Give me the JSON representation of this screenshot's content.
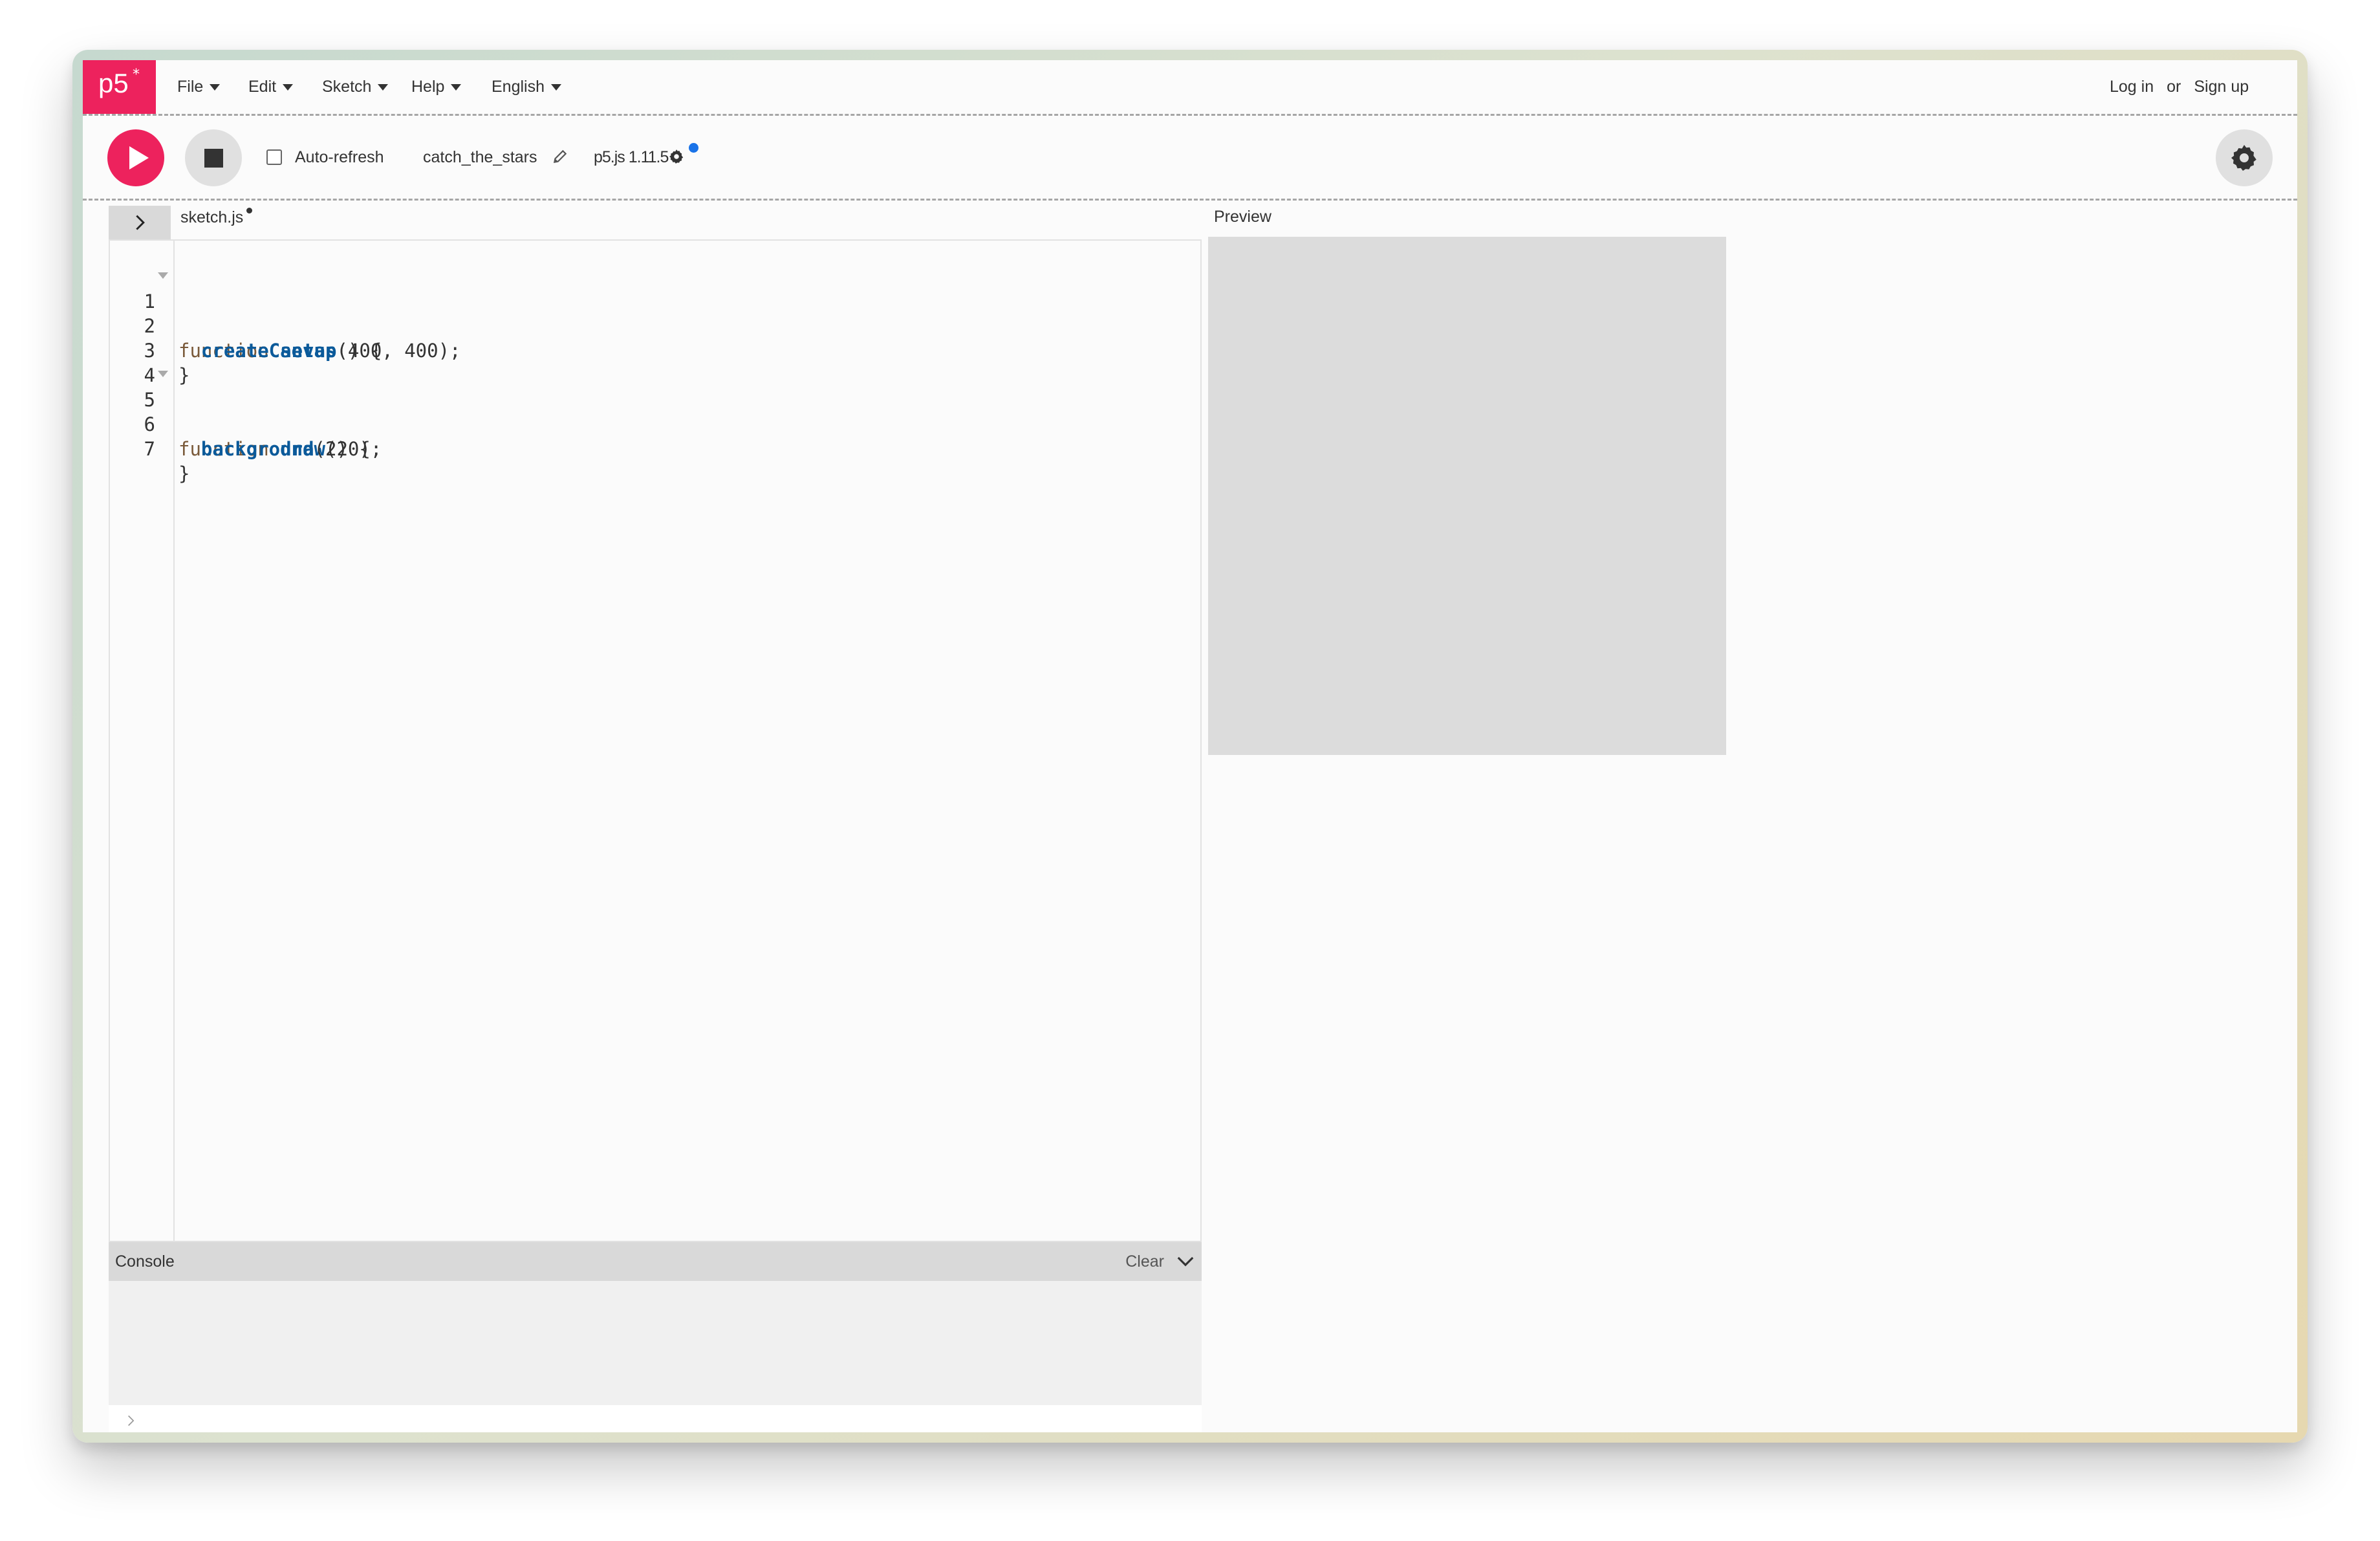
{
  "nav": {
    "logo": "p5",
    "logo_star": "*",
    "menus": [
      "File",
      "Edit",
      "Sketch",
      "Help",
      "English"
    ],
    "login": "Log in",
    "or": "or",
    "signup": "Sign up"
  },
  "toolbar": {
    "auto_refresh_label": "Auto-refresh",
    "auto_refresh_checked": false,
    "sketch_name": "catch_the_stars",
    "version": "p5.js 1.11.5"
  },
  "editor": {
    "file_name": "sketch.js",
    "lines": [
      {
        "no": "1",
        "fold": true
      },
      {
        "no": "2",
        "fold": false
      },
      {
        "no": "3",
        "fold": false
      },
      {
        "no": "4",
        "fold": false
      },
      {
        "no": "5",
        "fold": true
      },
      {
        "no": "6",
        "fold": false
      },
      {
        "no": "7",
        "fold": false
      }
    ],
    "code": {
      "l1_kw": "function",
      "l1_fn": "setup",
      "l1_rest": "() {",
      "l2_fn": "createCanvas",
      "l2_rest": "(400, 400);",
      "l3": "}",
      "l5_kw": "function",
      "l5_fn": "draw",
      "l5_rest": "() {",
      "l6_fn": "background",
      "l6_rest": "(220);",
      "l7": "}"
    }
  },
  "console": {
    "title": "Console",
    "clear": "Clear"
  },
  "preview": {
    "label": "Preview",
    "canvas_color": "#dcdcdc"
  },
  "colors": {
    "accent": "#ed225d",
    "unsaved_indicator": "#1a73e8"
  },
  "icons": [
    "play-icon",
    "stop-icon",
    "pencil-icon",
    "gear-icon",
    "chevron-right-icon",
    "chevron-down-icon"
  ]
}
